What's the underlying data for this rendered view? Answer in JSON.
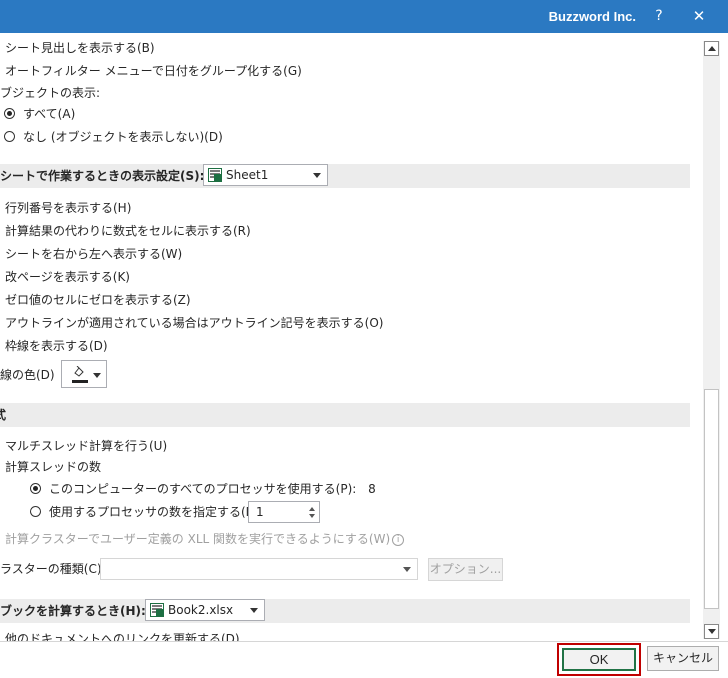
{
  "titlebar": {
    "title": "Buzzword Inc.",
    "help": "?",
    "close": "✕"
  },
  "options": {
    "show_sheet_tabs": "シート見出しを表示する(B)",
    "group_dates": "オートフィルター メニューで日付をグループ化する(G)",
    "objects_heading": "ブジェクトの表示:",
    "objects_all": "すべて(A)",
    "objects_none": "なし (オブジェクトを表示しない)(D)"
  },
  "sheet_section": {
    "label": "シートで作業するときの表示設定(S):",
    "sheet_value": "Sheet1",
    "items": [
      "行列番号を表示する(H)",
      "計算結果の代わりに数式をセルに表示する(R)",
      "シートを右から左へ表示する(W)",
      "改ページを表示する(K)",
      "ゼロ値のセルにゼロを表示する(Z)",
      "アウトラインが適用されている場合はアウトライン記号を表示する(O)",
      "枠線を表示する(D)"
    ],
    "gridline_color_label": "線の色(D)"
  },
  "formulas_section": {
    "label": "式",
    "multithread": "マルチスレッド計算を行う(U)",
    "threads_heading": "計算スレッドの数",
    "use_all_processors": "このコンピューターのすべてのプロセッサを使用する(P):",
    "processor_count": "8",
    "manual_processors": "使用するプロセッサの数を指定する(M):",
    "manual_value": "1",
    "xll_cluster": "計算クラスターでユーザー定義の XLL 関数を実行できるようにする(W)",
    "cluster_type_label": "ラスターの種類(C):",
    "options_button": "オプション..."
  },
  "workbook_section": {
    "label": "ブックを計算するとき(H):",
    "workbook_value": "Book2.xlsx",
    "partial_item": "他のドキュメントへのリンクを更新する(D)"
  },
  "footer": {
    "ok": "OK",
    "cancel": "キャンセル"
  }
}
